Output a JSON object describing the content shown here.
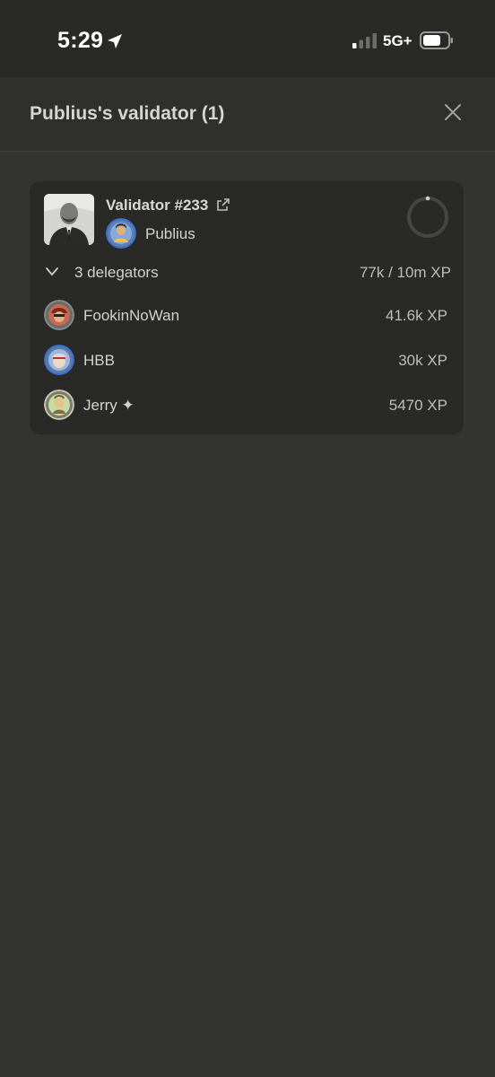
{
  "status_bar": {
    "time": "5:29",
    "network": "5G+",
    "location_icon": "location-arrow-icon",
    "signal_icon": "cellular-signal-icon",
    "battery_icon": "battery-icon"
  },
  "header": {
    "title": "Publius's validator (1)",
    "close_icon": "close-icon"
  },
  "validator": {
    "name": "Validator #233",
    "link_icon": "external-link-icon",
    "owner": "Publius",
    "progress_icon": "progress-ring"
  },
  "delegators": {
    "label": "3 delegators",
    "xp": "77k / 10m XP",
    "items": [
      {
        "name": "FookinNoWan",
        "xp": "41.6k XP"
      },
      {
        "name": "HBB",
        "xp": "30k XP"
      },
      {
        "name": "Jerry ✦",
        "xp": "5470 XP"
      }
    ]
  },
  "colors": {
    "background": "#333331",
    "status_bar": "#292928",
    "card": "#292927",
    "text": "#d2d2cf",
    "muted": "#bdbdba"
  }
}
